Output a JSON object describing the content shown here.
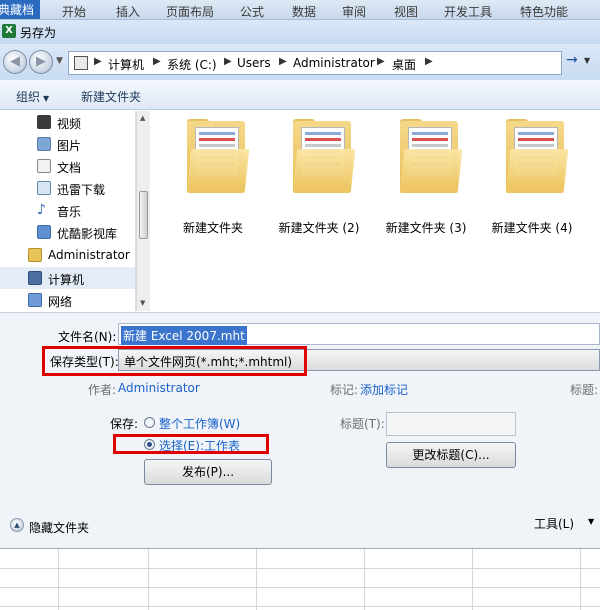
{
  "ribbon": {
    "tabs": [
      "开始",
      "插入",
      "页面布局",
      "公式",
      "数据",
      "审阅",
      "视图",
      "开发工具",
      "特色功能"
    ],
    "active_tab": "典藏档"
  },
  "dialog": {
    "title": "另存为",
    "address": {
      "crumbs": [
        "计算机",
        "系统 (C:)",
        "Users",
        "Administrator",
        "桌面"
      ]
    },
    "toolbar": {
      "organize": "组织",
      "new_folder": "新建文件夹"
    },
    "nav_items": [
      {
        "label": "视频",
        "icon": "video-icon"
      },
      {
        "label": "图片",
        "icon": "picture-icon"
      },
      {
        "label": "文档",
        "icon": "document-icon"
      },
      {
        "label": "迅雷下载",
        "icon": "download-icon"
      },
      {
        "label": "音乐",
        "icon": "music-icon"
      },
      {
        "label": "优酷影视库",
        "icon": "library-icon"
      },
      {
        "label": "Administrator",
        "icon": "user-folder-icon"
      },
      {
        "label": "计算机",
        "icon": "computer-icon"
      },
      {
        "label": "网络",
        "icon": "network-icon"
      }
    ],
    "folders": [
      {
        "label": "新建文件夹"
      },
      {
        "label": "新建文件夹 (2)"
      },
      {
        "label": "新建文件夹 (3)"
      },
      {
        "label": "新建文件夹 (4)"
      }
    ],
    "form": {
      "filename_label": "文件名(N):",
      "filename_value": "新建 Excel 2007.mht",
      "type_label": "保存类型(T):",
      "type_value": "单个文件网页(*.mht;*.mhtml)",
      "author_label": "作者:",
      "author_value": "Administrator",
      "tags_label": "标记:",
      "tags_link": "添加标记",
      "title_meta_label": "标题:",
      "save_label": "保存:",
      "radio_workbook": "整个工作簿(W)",
      "radio_selection": "选择(E):工作表",
      "title_field_label": "标题(T):",
      "publish_button": "发布(P)...",
      "change_title_button": "更改标题(C)...",
      "hide_folders": "隐藏文件夹",
      "tools": "工具(L)"
    }
  }
}
